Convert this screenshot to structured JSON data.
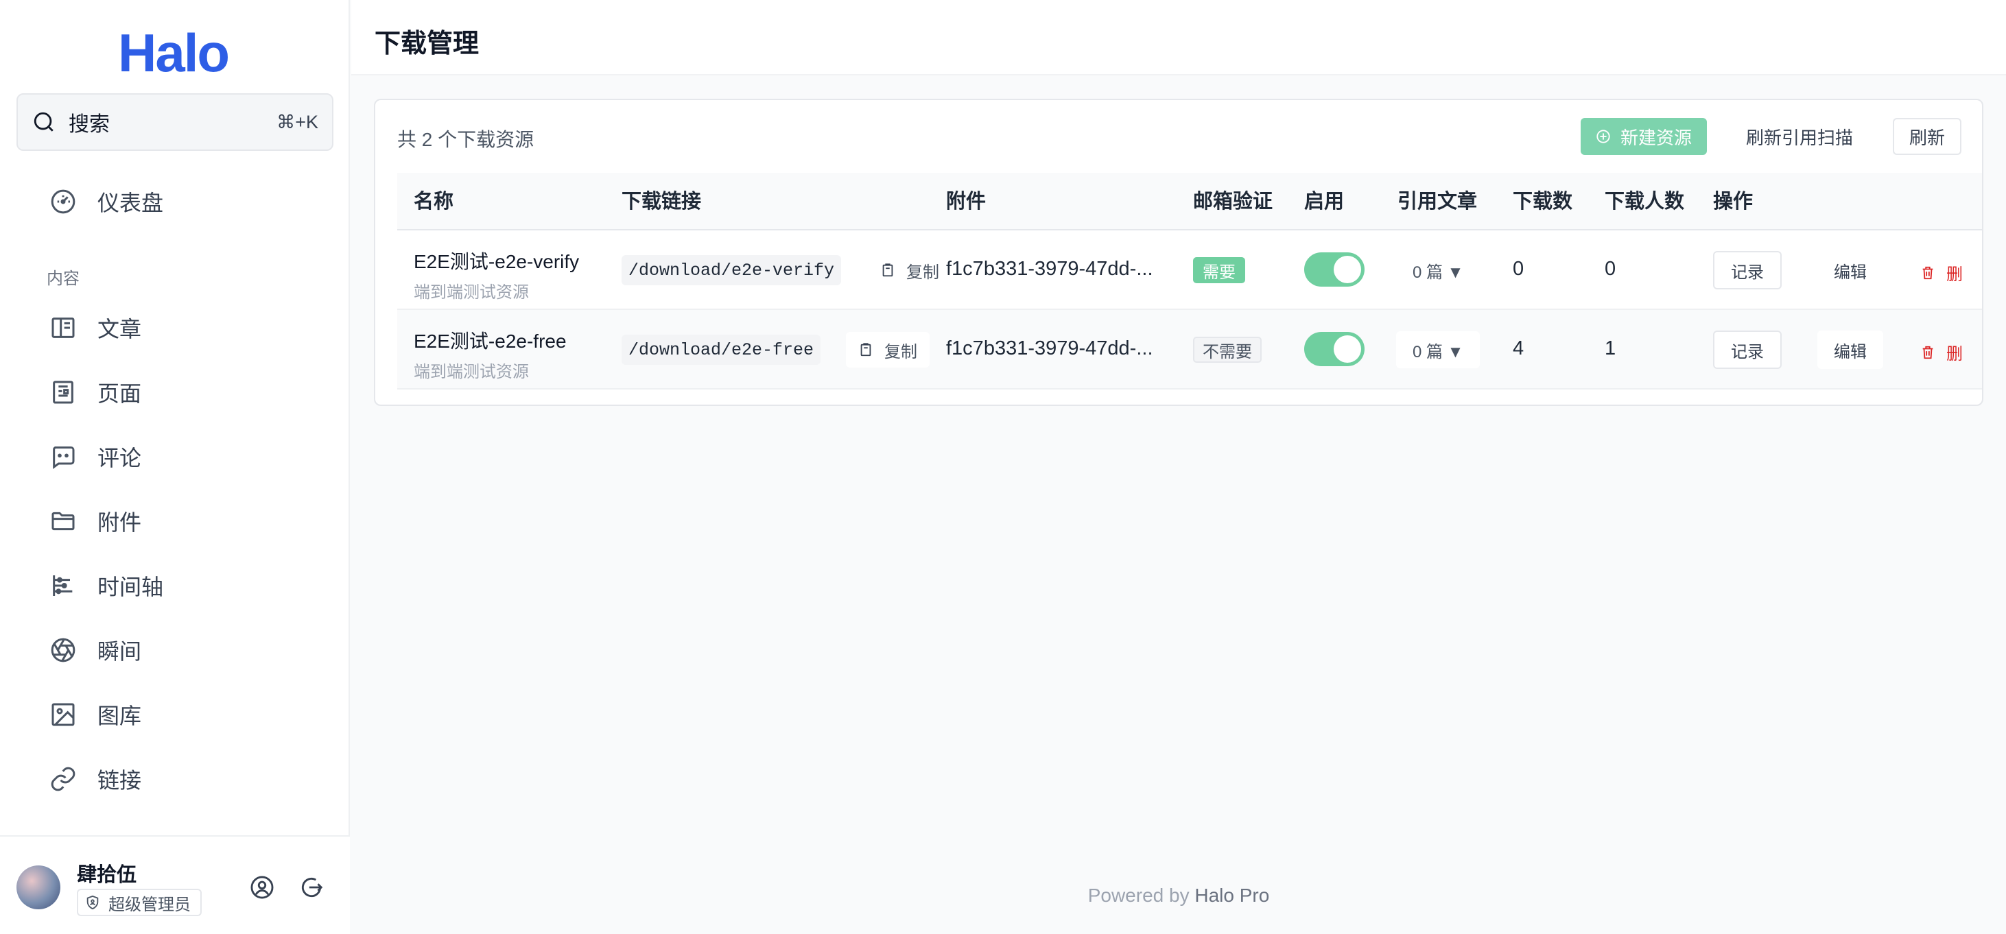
{
  "sidebar": {
    "logo": "Halo",
    "search": {
      "label": "搜索",
      "shortcut": "⌘+K"
    },
    "dashboard": "仪表盘",
    "section_content": "内容",
    "items": [
      {
        "label": "文章",
        "icon": "book-icon"
      },
      {
        "label": "页面",
        "icon": "page-icon"
      },
      {
        "label": "评论",
        "icon": "comment-icon"
      },
      {
        "label": "附件",
        "icon": "folder-icon"
      },
      {
        "label": "时间轴",
        "icon": "timeline-icon"
      },
      {
        "label": "瞬间",
        "icon": "aperture-icon"
      },
      {
        "label": "图库",
        "icon": "image-icon"
      },
      {
        "label": "链接",
        "icon": "link-icon"
      }
    ],
    "user": {
      "name": "肆拾伍",
      "role": "超级管理员"
    }
  },
  "header": {
    "title": "下载管理"
  },
  "toolbar": {
    "total": "共 2 个下载资源",
    "new_label": "新建资源",
    "rescan_label": "刷新引用扫描",
    "refresh_label": "刷新"
  },
  "table": {
    "columns": [
      "名称",
      "下载链接",
      "附件",
      "邮箱验证",
      "启用",
      "引用文章",
      "下载数",
      "下载人数",
      "操作"
    ],
    "copy_label": "复制",
    "record_label": "记录",
    "edit_label": "编辑",
    "delete_label": "删",
    "rows": [
      {
        "name": "E2E测试-e2e-verify",
        "description": "端到端测试资源",
        "link": "/download/e2e-verify",
        "attachment": "f1c7b331-3979-47dd-...",
        "email_verify": "需要",
        "enabled": true,
        "refs": "0 篇 ▼",
        "downloads": "0",
        "downloaders": "0"
      },
      {
        "name": "E2E测试-e2e-free",
        "description": "端到端测试资源",
        "link": "/download/e2e-free",
        "attachment": "f1c7b331-3979-47dd-...",
        "email_verify": "不需要",
        "enabled": true,
        "refs": "0 篇 ▼",
        "downloads": "4",
        "downloaders": "1"
      }
    ]
  },
  "footer": {
    "prefix": "Powered by ",
    "brand": "Halo Pro"
  },
  "colors": {
    "brand": "#2e5ee6",
    "accent": "#6fcf9f",
    "danger": "#dc2626"
  }
}
